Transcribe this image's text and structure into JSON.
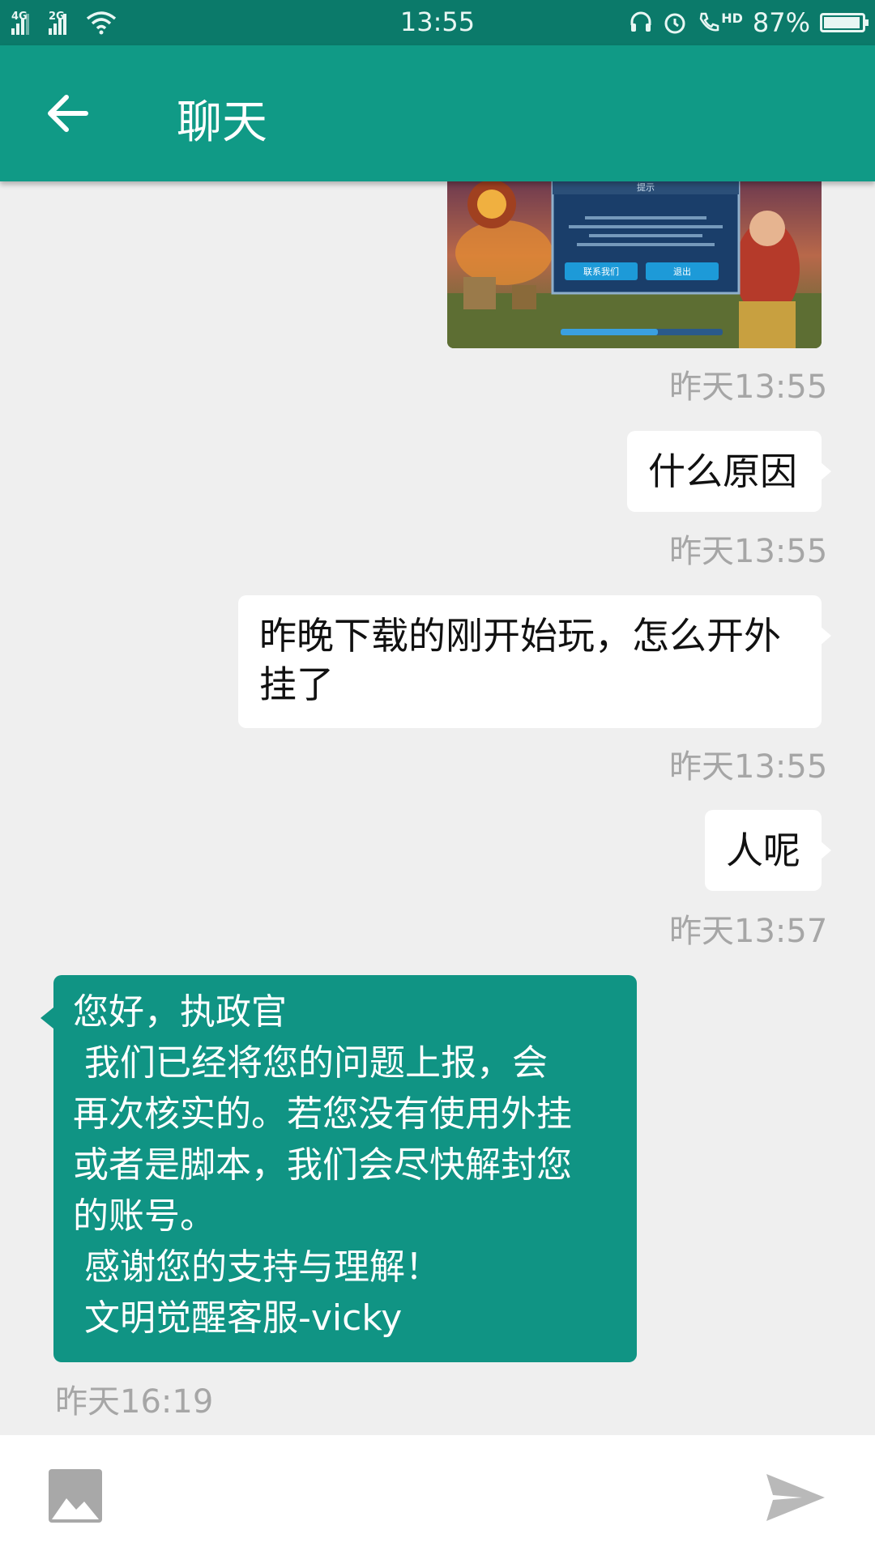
{
  "status_bar": {
    "time": "13:55",
    "battery": "87%",
    "network1": "4G",
    "network2": "2G",
    "hd_label": "HD",
    "icons": [
      "signal-4g-icon",
      "signal-2g-icon",
      "wifi-icon",
      "headset-icon",
      "alarm-icon",
      "volte-call-icon",
      "battery-icon"
    ]
  },
  "header": {
    "title": "聊天",
    "back_icon": "arrow-left-icon"
  },
  "messages": [
    {
      "type": "image",
      "time": "昨天13:55",
      "image": {
        "dialog_title": "提示",
        "button_contact": "联系我们",
        "button_exit": "退出"
      }
    },
    {
      "type": "text",
      "direction": "outgoing",
      "text": "什么原因",
      "time": "昨天13:55"
    },
    {
      "type": "text",
      "direction": "outgoing",
      "lines": [
        "昨晚下载的刚开始玩，怎么开外",
        "挂了"
      ],
      "time": "昨天13:55"
    },
    {
      "type": "text",
      "direction": "outgoing",
      "text": "人呢",
      "time": "昨天13:57"
    },
    {
      "type": "text",
      "direction": "incoming",
      "lines": [
        "您好，执政官",
        " 我们已经将您的问题上报，会",
        "再次核实的。若您没有使用外挂",
        "或者是脚本，我们会尽快解封您",
        "的账号。",
        " 感谢您的支持与理解！",
        " 文明觉醒客服-vicky"
      ],
      "time": "昨天16:19"
    }
  ],
  "input_bar": {
    "image_icon": "image-icon",
    "send_icon": "send-icon"
  },
  "colors": {
    "status_bar": "#0b7a6a",
    "app_bar": "#109a86",
    "incoming_bubble": "#109484",
    "background": "#efefef",
    "timestamp": "#a6a6a6"
  }
}
